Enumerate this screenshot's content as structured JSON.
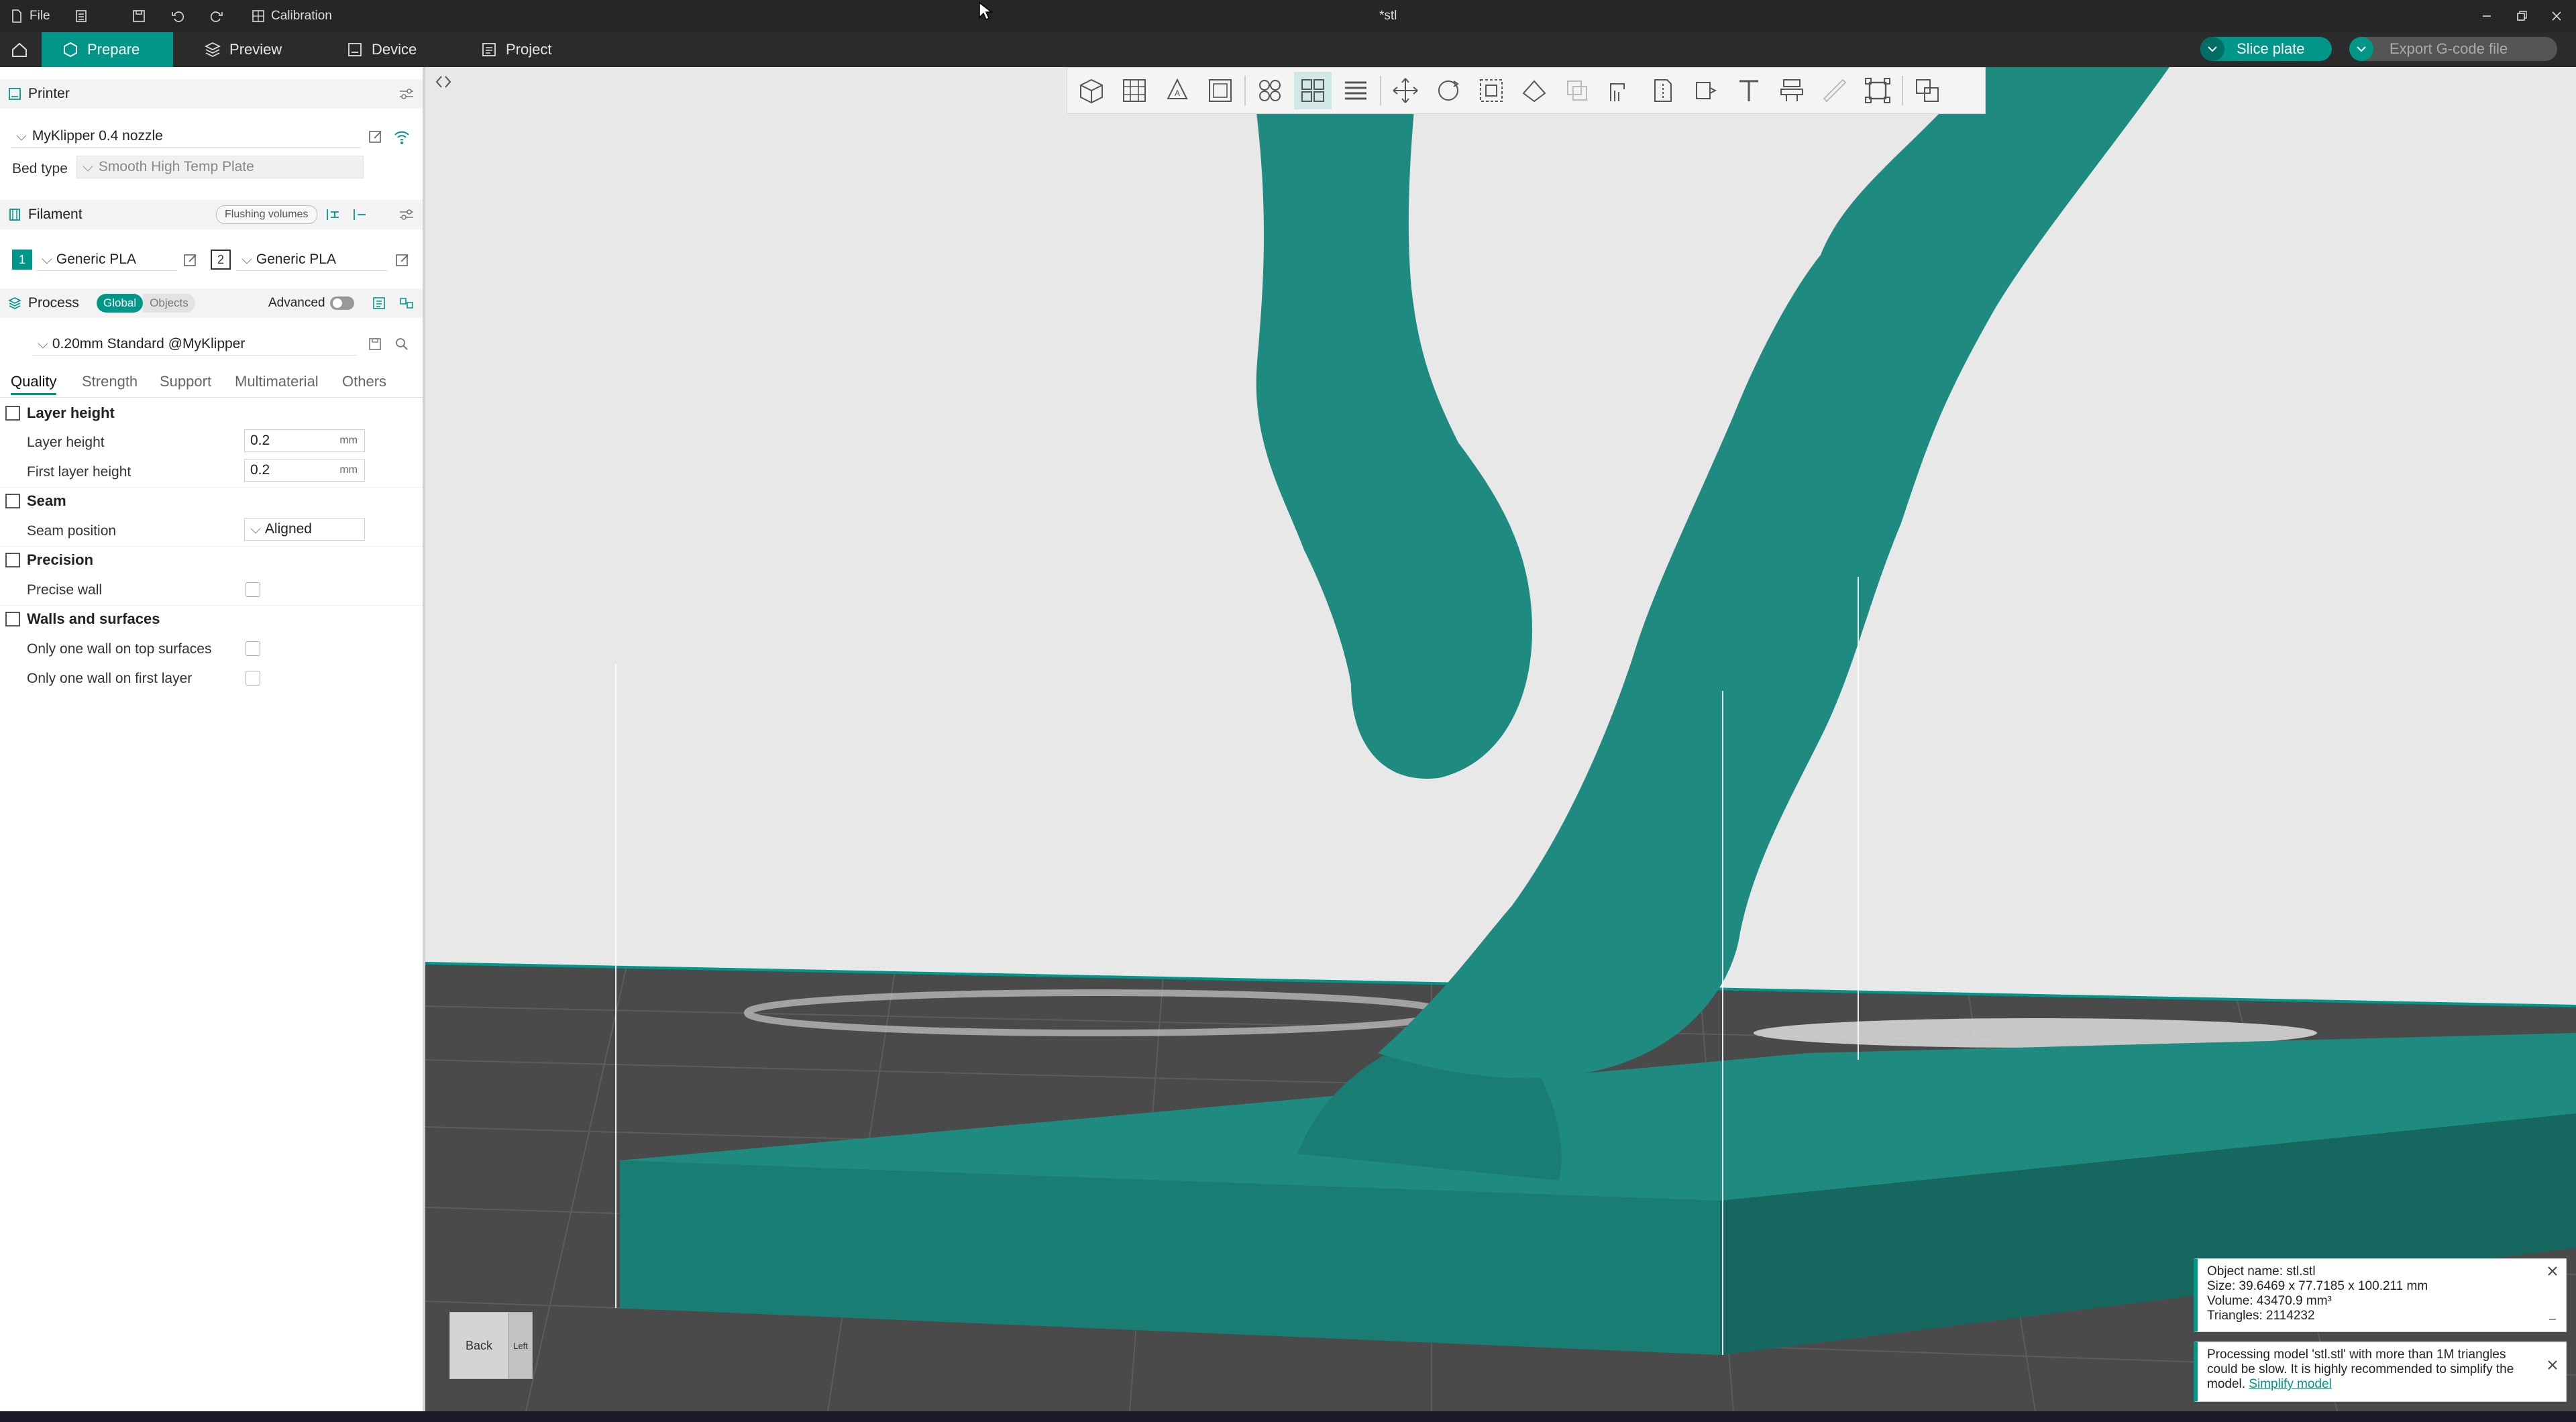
{
  "titlebar": {
    "file_label": "File",
    "calibration_label": "Calibration",
    "title": "*stl"
  },
  "tabs": {
    "prepare": "Prepare",
    "preview": "Preview",
    "device": "Device",
    "project": "Project"
  },
  "actions": {
    "slice": "Slice plate",
    "export": "Export G-code file"
  },
  "printer": {
    "section": "Printer",
    "name": "MyKlipper 0.4 nozzle",
    "bed_label": "Bed type",
    "bed_value": "Smooth High Temp Plate"
  },
  "filament": {
    "section": "Filament",
    "flushing": "Flushing volumes",
    "slots": [
      {
        "num": "1",
        "name": "Generic PLA"
      },
      {
        "num": "2",
        "name": "Generic PLA"
      }
    ]
  },
  "process": {
    "section": "Process",
    "global": "Global",
    "objects": "Objects",
    "advanced": "Advanced",
    "preset": "0.20mm Standard @MyKlipper"
  },
  "subtabs": [
    "Quality",
    "Strength",
    "Support",
    "Multimaterial",
    "Others"
  ],
  "quality": {
    "layer_height_group": "Layer height",
    "layer_height_label": "Layer height",
    "layer_height_value": "0.2",
    "first_layer_label": "First layer height",
    "first_layer_value": "0.2",
    "unit": "mm",
    "seam_group": "Seam",
    "seam_label": "Seam position",
    "seam_value": "Aligned",
    "precision_group": "Precision",
    "precise_wall": "Precise wall",
    "walls_group": "Walls and surfaces",
    "one_wall_top": "Only one wall on top surfaces",
    "one_wall_first": "Only one wall on first layer"
  },
  "viewcube": {
    "back": "Back",
    "left": "Left"
  },
  "object_info": {
    "name": "Object name: stl.stl",
    "size": "Size: 39.6469 x 77.7185 x 100.211 mm",
    "volume": "Volume: 43470.9 mm³",
    "triangles": "Triangles: 2114232"
  },
  "warning": {
    "text": "Processing model 'stl.stl' with more than 1M triangles could be slow. It is highly recommended to simplify the model.",
    "link": "Simplify model"
  },
  "colors": {
    "accent": "#009688",
    "model": "#1f8a80"
  }
}
